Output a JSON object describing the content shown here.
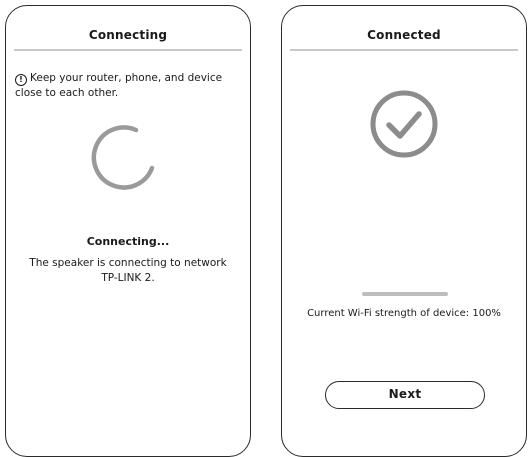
{
  "connecting_screen": {
    "title": "Connecting",
    "notice": "Keep your router, phone, and device close to each other.",
    "notice_icon": "info-icon",
    "spinner_icon": "loading-spinner-icon",
    "status_heading": "Connecting...",
    "status_text": "The speaker is connecting to network TP-LINK 2."
  },
  "connected_screen": {
    "title": "Connected",
    "check_icon": "check-circle-icon",
    "wifi_strength_text": "Current Wi-Fi strength of device: 100%",
    "wifi_strength_percent": 100,
    "next_label": "Next"
  },
  "colors": {
    "outline": "#2b2b2b",
    "divider": "#c8c8c8",
    "icon_gray": "#8c8c8c",
    "bar_gray": "#bdbdbd"
  }
}
